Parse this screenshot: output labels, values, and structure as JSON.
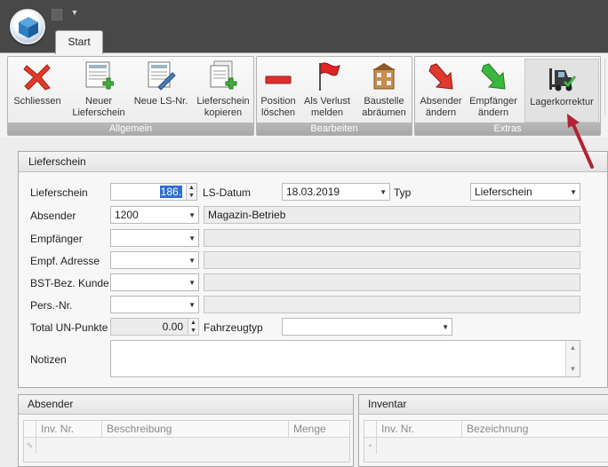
{
  "ribbon": {
    "active_tab": "Start",
    "groups": [
      {
        "label": "Allgemein",
        "buttons": [
          {
            "label": "Schliessen",
            "icon": "close-x-icon"
          },
          {
            "label": "Neuer\nLieferschein",
            "icon": "new-delivery-note-icon"
          },
          {
            "label": "Neue LS-Nr.",
            "icon": "new-number-icon"
          },
          {
            "label": "Lieferschein\nkopieren",
            "icon": "copy-delivery-note-icon"
          }
        ]
      },
      {
        "label": "Bearbeiten",
        "buttons": [
          {
            "label": "Position\nlöschen",
            "icon": "minus-icon"
          },
          {
            "label": "Als Verlust\nmelden",
            "icon": "red-flag-icon"
          },
          {
            "label": "Baustelle\nabräumen",
            "icon": "building-icon"
          }
        ]
      },
      {
        "label": "Extras",
        "buttons": [
          {
            "label": "Absender\nändern",
            "icon": "arrow-down-red-icon"
          },
          {
            "label": "Empfänger\nändern",
            "icon": "arrow-down-green-icon"
          },
          {
            "label": "Lagerkorrektur",
            "icon": "forklift-icon"
          }
        ]
      }
    ]
  },
  "form": {
    "title": "Lieferschein",
    "lieferschein_label": "Lieferschein",
    "lieferschein_value": "186.",
    "ls_datum_label": "LS-Datum",
    "ls_datum_value": "18.03.2019",
    "typ_label": "Typ",
    "typ_value": "Lieferschein",
    "absender_label": "Absender",
    "absender_value": "1200",
    "absender_name": "Magazin-Betrieb",
    "empfaenger_label": "Empfänger",
    "empf_adresse_label": "Empf. Adresse",
    "bst_label": "BST-Bez. Kunde",
    "pers_label": "Pers.-Nr.",
    "un_punkte_label": "Total UN-Punkte",
    "un_punkte_value": "0.00",
    "fahrzeugtyp_label": "Fahrzeugtyp",
    "notizen_label": "Notizen"
  },
  "absender_grid": {
    "title": "Absender",
    "columns": [
      "Inv. Nr.",
      "Beschreibung",
      "Menge"
    ]
  },
  "inventar_grid": {
    "title": "Inventar",
    "columns": [
      "Inv. Nr.",
      "Bezeichnung"
    ]
  },
  "colors": {
    "annotation": "#b22234",
    "selection": "#2f6fcf"
  }
}
